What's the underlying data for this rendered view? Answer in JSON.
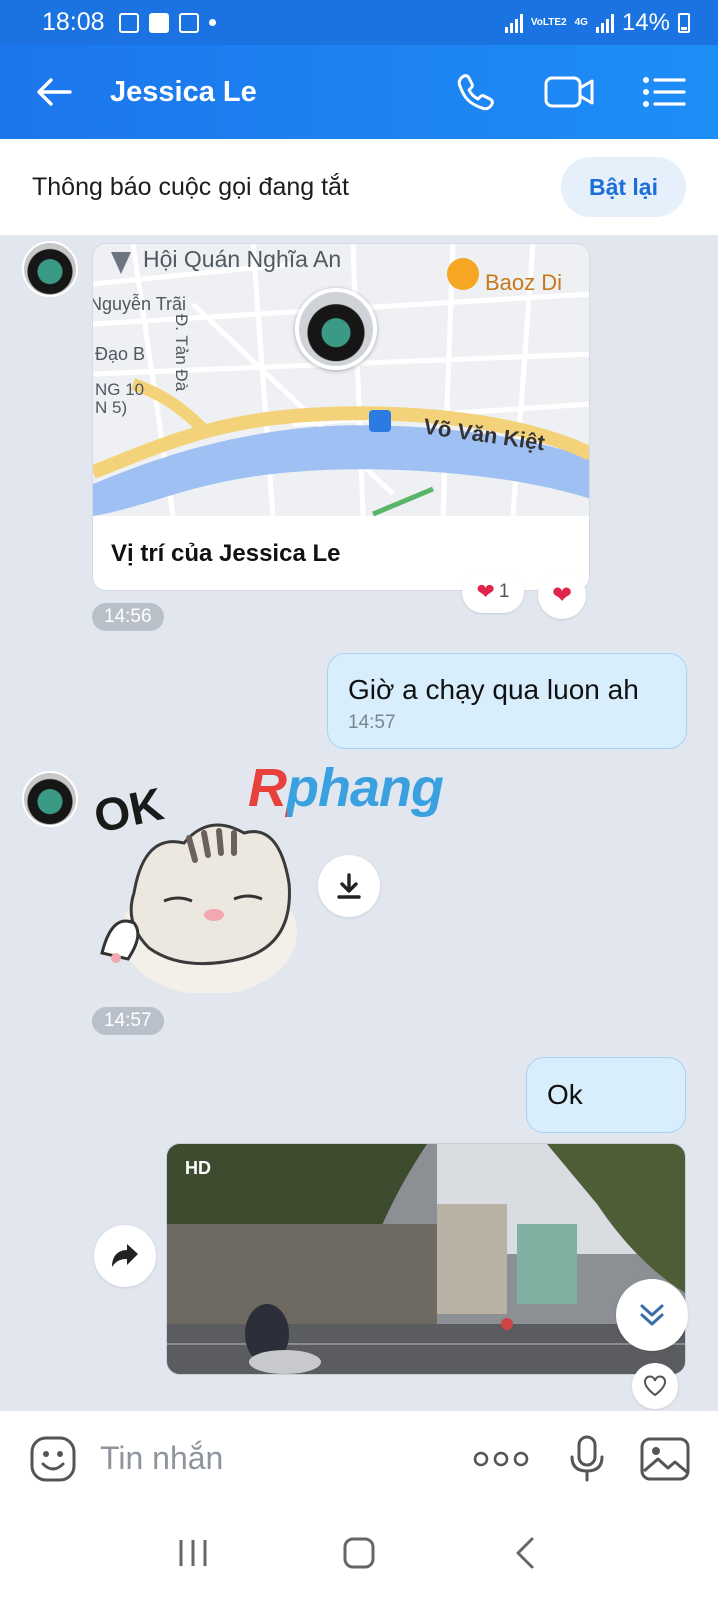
{
  "status_bar": {
    "time": "18:08",
    "network": "4G",
    "carrier": "VoLTE2",
    "battery": "14%"
  },
  "header": {
    "title": "Jessica Le"
  },
  "notice": {
    "text": "Thông báo cuộc gọi đang tắt",
    "button": "Bật lại"
  },
  "messages": {
    "location": {
      "caption": "Vị trí của Jessica Le",
      "map_labels": [
        "Hội Quán Nghĩa An",
        "Baoz Di",
        "Nguyễn Trãi",
        "Đ. Tản Đà",
        "Đạo B",
        "NG 10",
        "N 5)",
        "Võ Văn Kiệt"
      ],
      "reaction_count": "1",
      "time": "14:56"
    },
    "outgoing_1": {
      "text": "Giờ a chạy qua luon ah",
      "time": "14:57"
    },
    "sticker": {
      "text": "OK",
      "time": "14:57"
    },
    "outgoing_2": {
      "text": "Ok"
    },
    "video": {
      "badge": "HD"
    }
  },
  "watermark": "Rphang",
  "input": {
    "placeholder": "Tin nhắn"
  },
  "colors": {
    "header": "#1b76ec",
    "outgoing_bubble": "#d8eefc",
    "chat_bg": "#e2e7ef",
    "link": "#1a6fd9"
  }
}
